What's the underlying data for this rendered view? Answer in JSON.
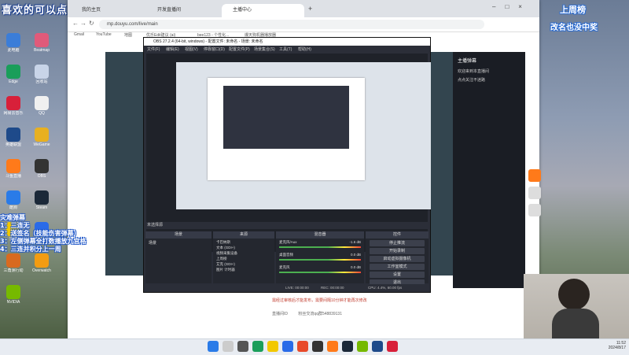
{
  "overlay": {
    "top_banner": "喜欢的可以点点关注",
    "mod_title": "灾难弹幕",
    "mod_lines": [
      "1：三连无",
      "2：送签名（技能伤害弹幕）",
      "3：左侧弹幕全打数播放九宫格",
      "4：三连并积分上一周"
    ],
    "ranking_title": "上周榜",
    "ranking_sub": "改名也没中奖"
  },
  "desktop_icons": [
    {
      "label": "此电脑",
      "color": "#3b7dd8"
    },
    {
      "label": "Beatmap",
      "color": "#e05a7a"
    },
    {
      "label": "Edge",
      "color": "#1a9e5a"
    },
    {
      "label": "回收站",
      "color": "#c8d4e8"
    },
    {
      "label": "网易云音乐",
      "color": "#d8203a"
    },
    {
      "label": "QQ",
      "color": "#f0f0f0"
    },
    {
      "label": "英雄联盟",
      "color": "#1e4a8a"
    },
    {
      "label": "WeGame",
      "color": "#e8b020"
    },
    {
      "label": "斗鱼直播",
      "color": "#ff7a1a"
    },
    {
      "label": "OBS",
      "color": "#333"
    },
    {
      "label": "酷狗",
      "color": "#2a7be8"
    },
    {
      "label": "Steam",
      "color": "#1b2838"
    },
    {
      "label": "雷神",
      "color": "#f2c800"
    },
    {
      "label": "腾讯会议",
      "color": "#2a6be8"
    },
    {
      "label": "三角洲行动",
      "color": "#d86a20"
    },
    {
      "label": "Overwatch",
      "color": "#f39c12"
    },
    {
      "label": "NVIDIA",
      "color": "#76b900"
    }
  ],
  "browser": {
    "tabs": [
      {
        "label": "我的主页",
        "active": false
      },
      {
        "label": "开发直播间",
        "active": false
      },
      {
        "label": "主播中心",
        "active": true
      }
    ],
    "url": "mp.douyu.com/live/main",
    "bookmarks": [
      "Gmail",
      "YouTube",
      "地图",
      "优乐Edit建议 (ai)",
      "bee123 - 个性化...",
      "爆天狗机器播放器"
    ]
  },
  "obs": {
    "title": "OBS 27.2.4 (64-bit, windows) - 配置文件: 未命名 - 场景: 未命名",
    "menu": [
      "文件(F)",
      "编辑(E)",
      "视图(V)",
      "停靠窗口(D)",
      "配置文件(P)",
      "场景集合(S)",
      "工具(T)",
      "帮助(H)"
    ],
    "status_bar": "未选择源",
    "docks": {
      "scenes": {
        "title": "场景",
        "items": [
          "场景"
        ]
      },
      "sources": {
        "title": "来源",
        "items": [
          "卡巴纳斯",
          "文本 (GDI+)",
          "视频采集设备",
          "上周榜",
          "艾克 (GDI+)",
          "图片 计时器"
        ]
      },
      "mixer": {
        "title": "混音器",
        "channels": [
          {
            "name": "麦克风/Aux",
            "db": "-1.6 dB"
          },
          {
            "name": "桌面音频",
            "db": "0.0 dB"
          },
          {
            "name": "麦克风",
            "db": "0.0 dB"
          }
        ]
      },
      "controls": {
        "title": "控件",
        "buttons": [
          "停止推流",
          "开始录制",
          "启动虚拟摄像机",
          "工作室模式",
          "设置",
          "退出"
        ]
      }
    },
    "footer": {
      "live": "LIVE: 00:00:00",
      "rec": "REC: 00:00:00",
      "cpu": "CPU: 4.4%, 60.00 fps"
    }
  },
  "douyu": {
    "chat_header": "主播弹幕",
    "chat_lines": [
      "欢迎来到本直播间",
      "点点关注不迷路"
    ],
    "footer_notice": "需经过审核后才能发布，需要间隔10分钟才能再次修改",
    "footer_label": "直播间ID",
    "footer_value": "粉丝交流qq群548839131"
  },
  "taskbar": {
    "time": "11:52",
    "date": "2024/8/17"
  }
}
